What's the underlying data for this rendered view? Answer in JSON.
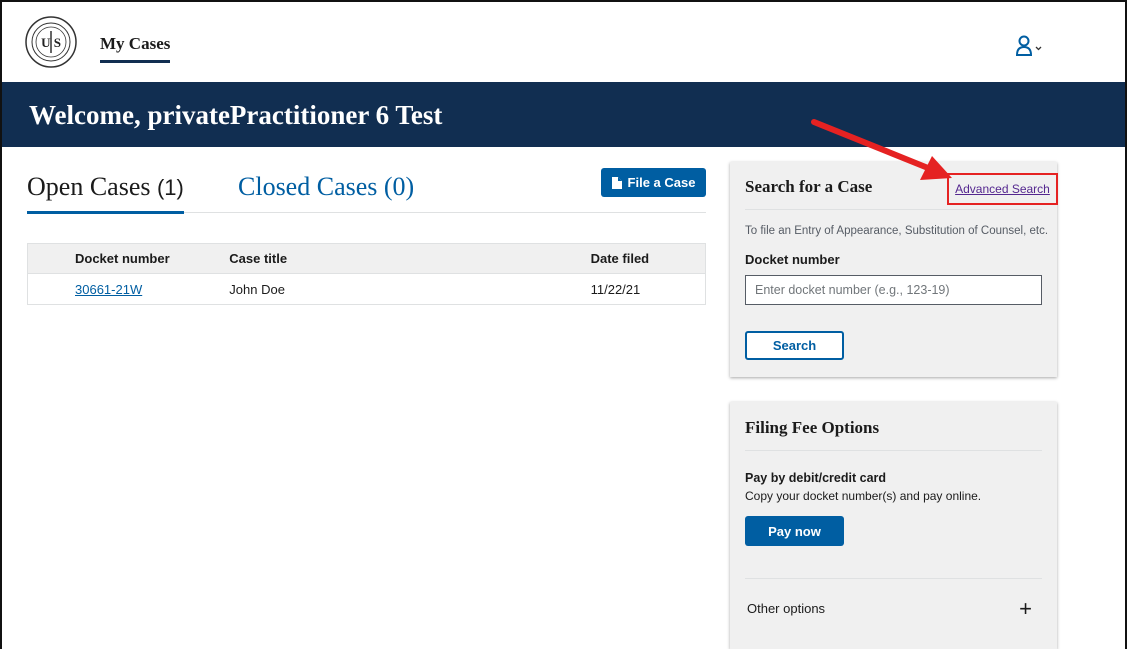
{
  "header": {
    "nav_link": "My Cases",
    "seal_text": "UNITED STATES TAX COURT",
    "seal_monogram": "U S"
  },
  "banner": {
    "title": "Welcome, privatePractitioner 6 Test"
  },
  "tabs": {
    "open_label": "Open Cases",
    "open_count": "(1)",
    "closed_label": "Closed Cases (0)"
  },
  "file_case_button": "File a Case",
  "cases_table": {
    "columns": [
      "Docket number",
      "Case title",
      "Date filed"
    ],
    "rows": [
      {
        "docket": "30661-21W",
        "title": "John Doe",
        "date": "11/22/21"
      }
    ]
  },
  "search_card": {
    "title": "Search for a Case",
    "advanced_link": "Advanced Search",
    "note": "To file an Entry of Appearance, Substitution of Counsel, etc.",
    "docket_label": "Docket number",
    "docket_placeholder": "Enter docket number (e.g., 123-19)",
    "search_button": "Search"
  },
  "fee_card": {
    "title": "Filing Fee Options",
    "pay_heading": "Pay by debit/credit card",
    "pay_text": "Copy your docket number(s) and pay online.",
    "pay_button": "Pay now",
    "other_options": "Other options",
    "expand_symbol": "+"
  },
  "colors": {
    "banner": "#112e51",
    "primary": "#005ea2",
    "highlight": "#e52222",
    "visited_link": "#54278f",
    "card_bg": "#f0f0f0"
  },
  "icons": {
    "seal": "court-seal-icon",
    "account": "user-account-icon",
    "file": "document-icon",
    "annotation_arrow": "red-arrow-icon"
  }
}
